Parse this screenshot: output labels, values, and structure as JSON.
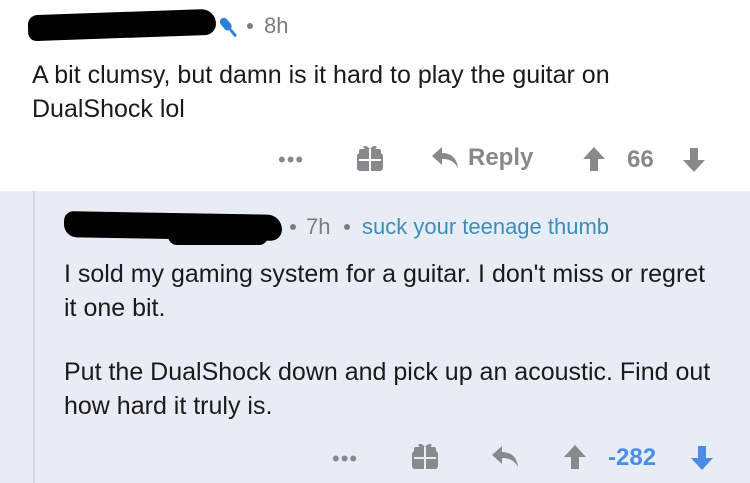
{
  "comment1": {
    "username": "",
    "time": "8h",
    "body": "A bit clumsy, but damn is it hard to play the guitar on DualShock lol",
    "actions": {
      "more": "•••",
      "reply_label": "Reply",
      "score": "66"
    }
  },
  "comment2": {
    "username": "",
    "time": "7h",
    "flair": "suck your teenage thumb",
    "body_p1": "I sold my gaming system for a guitar. I don't miss or regret it one bit.",
    "body_p2": "Put the DualShock down and pick up an acoustic. Find out how hard it truly is.",
    "actions": {
      "more": "•••",
      "score": "-282"
    }
  },
  "colors": {
    "meta_gray": "#7c7c7c",
    "action_gray": "#878a8c",
    "flair_blue": "#3c8dbc",
    "reply_bg": "#e8edf5",
    "mod_icon_blue": "#2f7fd6",
    "downvote_blue": "#4a8ce6"
  },
  "icons": [
    "microphone-icon",
    "gift-icon",
    "reply-arrow-icon",
    "upvote-icon",
    "downvote-icon"
  ]
}
